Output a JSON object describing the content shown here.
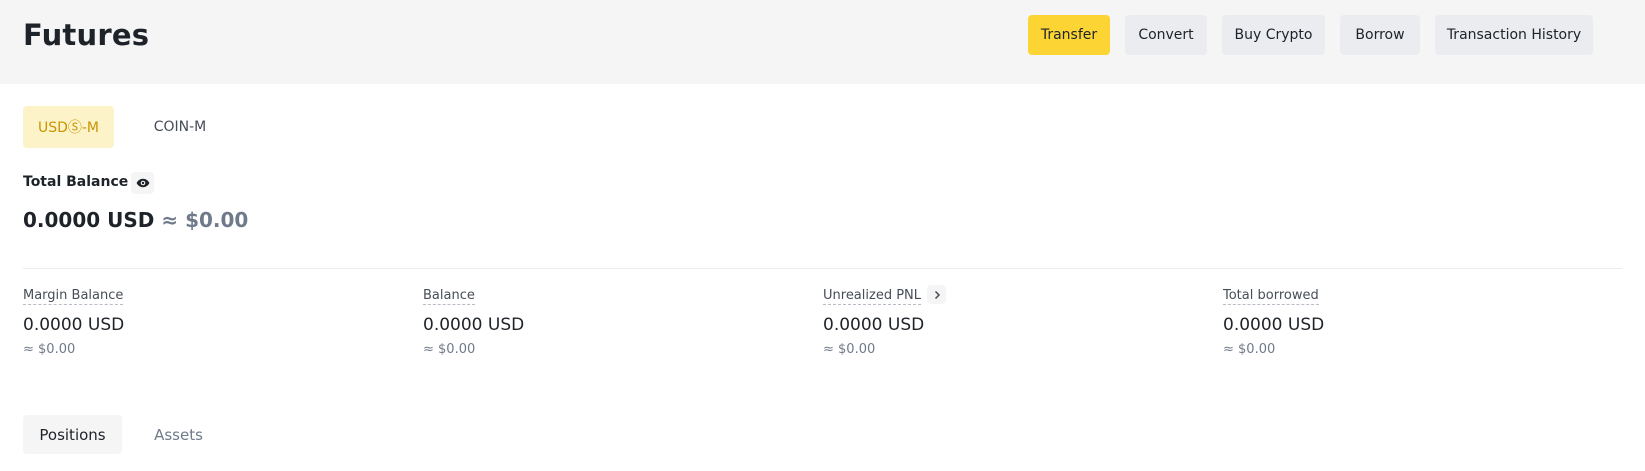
{
  "header": {
    "title": "Futures",
    "buttons": [
      {
        "label": "Transfer"
      },
      {
        "label": "Convert"
      },
      {
        "label": "Buy Crypto"
      },
      {
        "label": "Borrow"
      },
      {
        "label": "Transaction History"
      }
    ]
  },
  "subtabs": [
    {
      "label": "USDⓈ-M",
      "active": true
    },
    {
      "label": "COIN-M",
      "active": false
    }
  ],
  "balance": {
    "label": "Total Balance",
    "eye_icon": "eye-icon",
    "amount": "0.0000 USD",
    "approx": "≈ $0.00"
  },
  "stats": [
    {
      "label": "Margin Balance",
      "value": "0.0000 USD",
      "approx": "≈ $0.00"
    },
    {
      "label": "Balance",
      "value": "0.0000 USD",
      "approx": "≈ $0.00"
    },
    {
      "label": "Unrealized PNL",
      "value": "0.0000 USD",
      "approx": "≈ $0.00",
      "icon": "chevron-right-icon"
    },
    {
      "label": "Total borrowed",
      "value": "0.0000 USD",
      "approx": "≈ $0.00"
    }
  ],
  "bottom_tabs": [
    {
      "label": "Positions",
      "active": true
    },
    {
      "label": "Assets",
      "active": false
    }
  ],
  "colors": {
    "accent": "#fcd535",
    "active_subtab_bg": "#fdf3c8",
    "active_subtab_text": "#c99400",
    "header_bg": "#f5f5f5"
  }
}
